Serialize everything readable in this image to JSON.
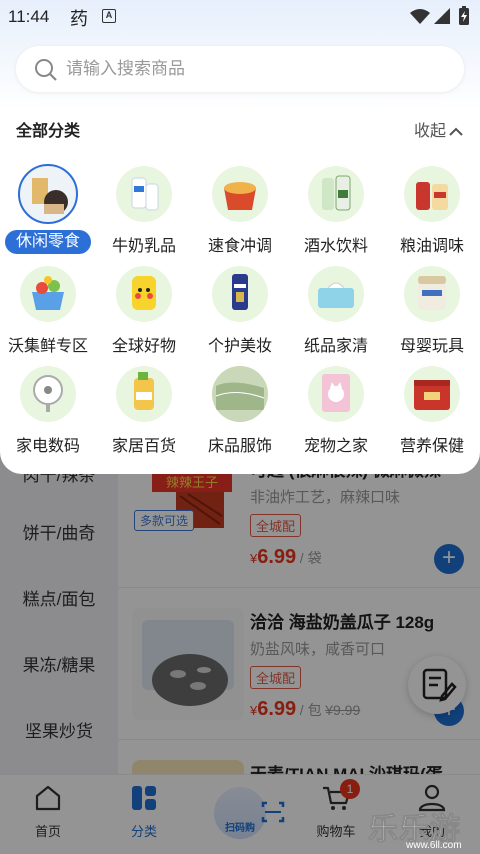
{
  "status_bar": {
    "time": "11:44",
    "app_glyph": "药",
    "indicator": "A",
    "icons": [
      "wifi-icon",
      "signal-icon",
      "battery-charging-icon"
    ]
  },
  "search": {
    "placeholder": "请输入搜索商品",
    "value": ""
  },
  "category_panel": {
    "title": "全部分类",
    "collapse_label": "收起",
    "categories": [
      {
        "label": "休闲零食",
        "active": true,
        "icon": "snacks-image"
      },
      {
        "label": "牛奶乳品",
        "active": false,
        "icon": "milk-image"
      },
      {
        "label": "速食冲调",
        "active": false,
        "icon": "instant-food-image"
      },
      {
        "label": "酒水饮料",
        "active": false,
        "icon": "drinks-image"
      },
      {
        "label": "粮油调味",
        "active": false,
        "icon": "grain-oil-image"
      },
      {
        "label": "沃集鲜专区",
        "active": false,
        "icon": "walmart-fresh-image"
      },
      {
        "label": "全球好物",
        "active": false,
        "icon": "global-goods-image"
      },
      {
        "label": "个护美妆",
        "active": false,
        "icon": "personal-care-image"
      },
      {
        "label": "纸品家清",
        "active": false,
        "icon": "paper-cleaning-image"
      },
      {
        "label": "母婴玩具",
        "active": false,
        "icon": "baby-toys-image"
      },
      {
        "label": "家电数码",
        "active": false,
        "icon": "appliance-image"
      },
      {
        "label": "家居百货",
        "active": false,
        "icon": "household-image"
      },
      {
        "label": "床品服饰",
        "active": false,
        "icon": "bedding-image"
      },
      {
        "label": "宠物之家",
        "active": false,
        "icon": "pet-image"
      },
      {
        "label": "营养保健",
        "active": false,
        "icon": "nutrition-image"
      }
    ]
  },
  "sidebar": {
    "items": [
      "肉干/辣条",
      "饼干/曲奇",
      "糕点/面包",
      "果冻/糖果",
      "坚果炒货"
    ]
  },
  "products": [
    {
      "title": "可匙 (很麻很辣) 微麻微辣",
      "desc": "非油炸工艺，麻辣口味",
      "tag": "全城配",
      "badge": "多款可选",
      "currency": "¥",
      "price": "6.99",
      "unit": "/ 袋",
      "original": ""
    },
    {
      "title": "洽洽 海盐奶盖瓜子 128g",
      "desc": "奶盐风味，咸香可口",
      "tag": "全城配",
      "badge": "",
      "currency": "¥",
      "price": "6.99",
      "unit": "/ 包",
      "original": "¥9.99"
    },
    {
      "title": "天麦/TIAN MAI 沙琪玛(蛋",
      "desc": "",
      "tag": "",
      "badge": "",
      "currency": "",
      "price": "",
      "unit": "",
      "original": ""
    }
  ],
  "tabbar": {
    "tabs": [
      {
        "label": "首页",
        "icon": "home-icon"
      },
      {
        "label": "分类",
        "icon": "category-icon",
        "active": true
      },
      {
        "label": "扫码购",
        "icon": "scan-icon"
      },
      {
        "label": "购物车",
        "icon": "cart-icon",
        "badge": "1"
      },
      {
        "label": "我的",
        "icon": "profile-icon"
      }
    ]
  },
  "watermark": {
    "text": "乐乐游戏",
    "url": "www.6ll.com"
  },
  "colors": {
    "accent": "#2c6fd6",
    "price": "#e8341c",
    "tag": "#e05a45"
  }
}
